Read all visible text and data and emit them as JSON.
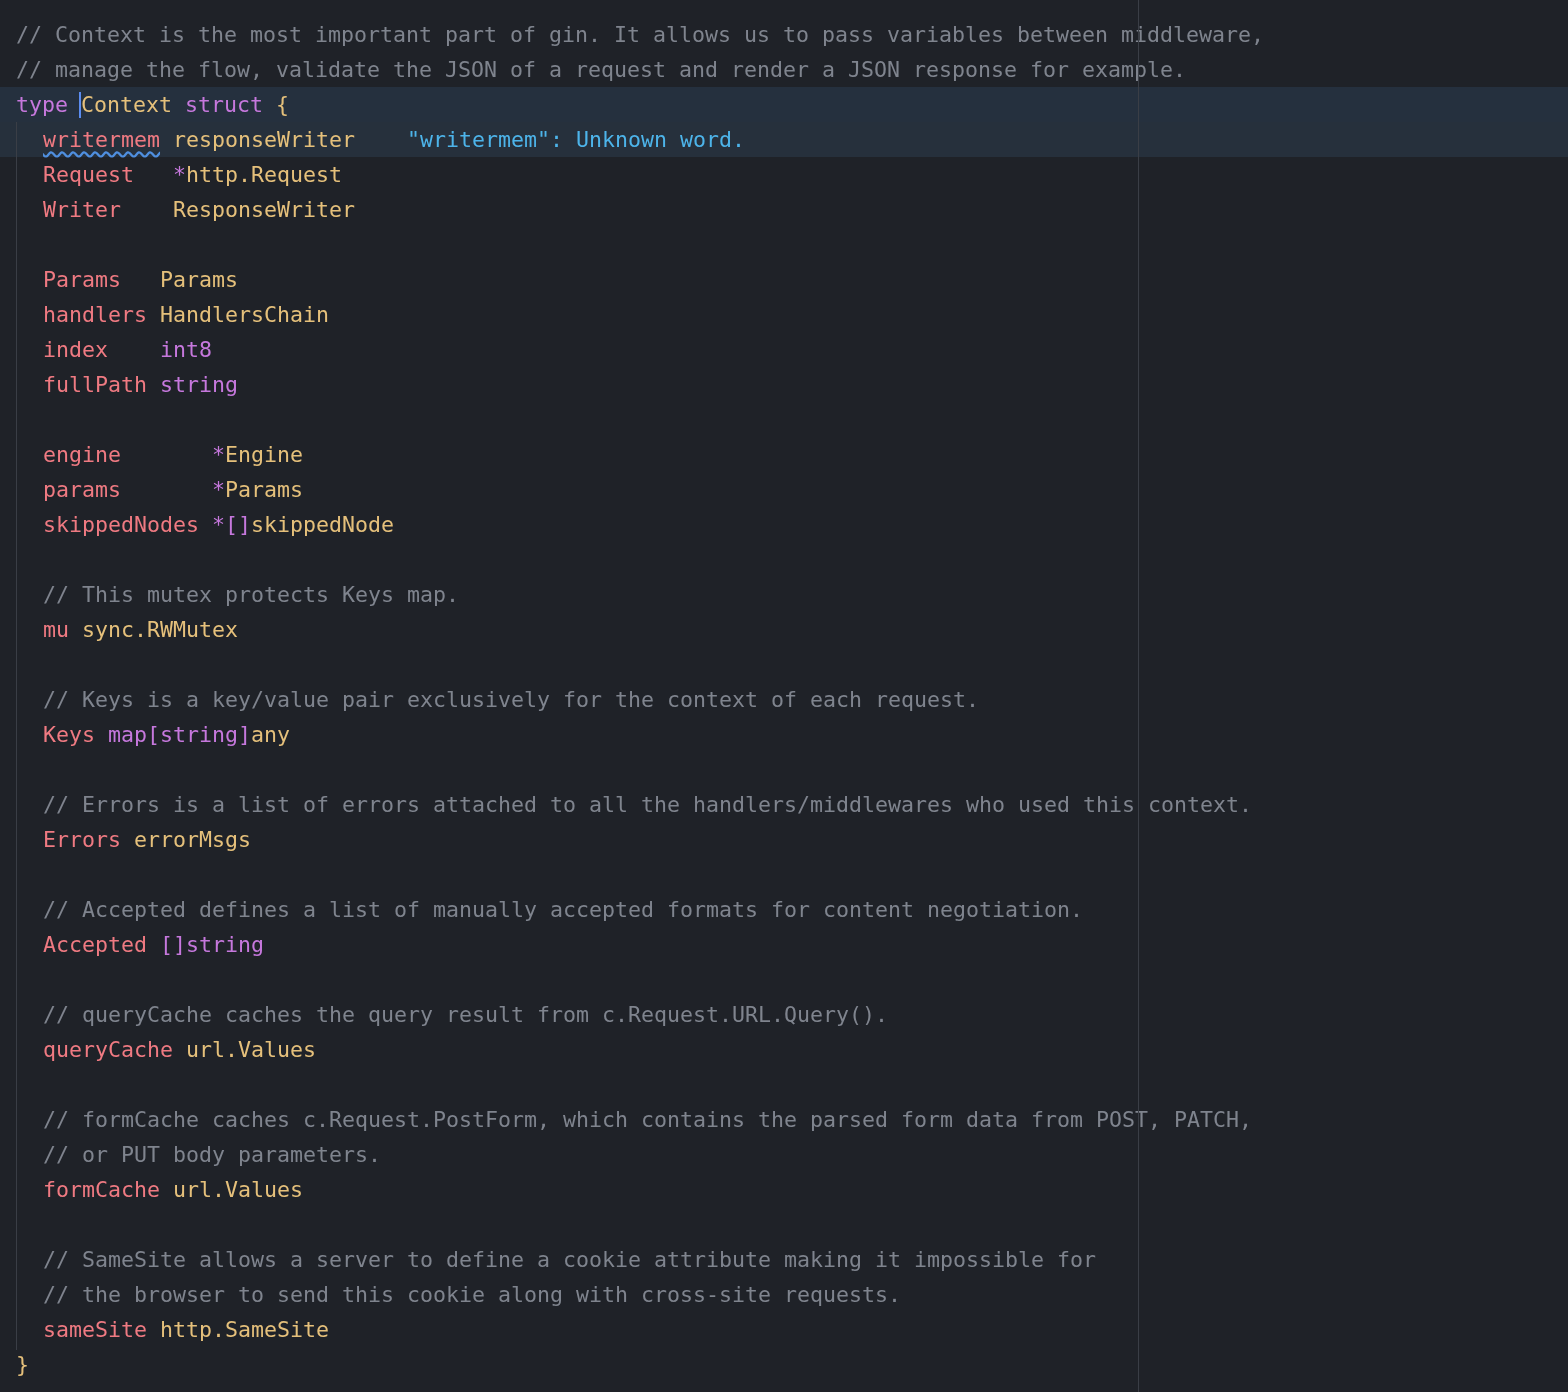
{
  "editor": {
    "lines": [
      {
        "kind": "comment",
        "text": "// Context is the most important part of gin. It allows us to pass variables between middleware,"
      },
      {
        "kind": "comment",
        "text": "// manage the flow, validate the JSON of a request and render a JSON response for example."
      },
      {
        "kind": "code",
        "current": true,
        "tokens": [
          {
            "kind": "keyword",
            "text": "type"
          },
          {
            "kind": "type",
            "text": "Context",
            "caret": true
          },
          {
            "kind": "keyword",
            "text": "struct"
          },
          {
            "kind": "brace",
            "text": "{"
          }
        ]
      },
      {
        "kind": "decl",
        "indent": true,
        "highlighted": true,
        "name": {
          "text": "writermem",
          "misspelled": true
        },
        "type": [
          {
            "kind": "type",
            "text": "responseWriter"
          }
        ],
        "hint": "\"writermem\": Unknown word."
      },
      {
        "kind": "decl",
        "indent": true,
        "name": {
          "text": "Request"
        },
        "type": [
          {
            "kind": "operator",
            "text": "*"
          },
          {
            "kind": "type",
            "text": "http.Request"
          }
        ]
      },
      {
        "kind": "decl",
        "indent": true,
        "name": {
          "text": "Writer"
        },
        "type": [
          {
            "kind": "type",
            "text": "ResponseWriter"
          }
        ]
      },
      {
        "kind": "blank"
      },
      {
        "kind": "decl",
        "indent": true,
        "name": {
          "text": "Params"
        },
        "type": [
          {
            "kind": "type",
            "text": "Params"
          }
        ]
      },
      {
        "kind": "decl",
        "indent": true,
        "name": {
          "text": "handlers"
        },
        "type": [
          {
            "kind": "type",
            "text": "HandlersChain"
          }
        ]
      },
      {
        "kind": "decl",
        "indent": true,
        "name": {
          "text": "index"
        },
        "type": [
          {
            "kind": "builtin",
            "text": "int8"
          }
        ]
      },
      {
        "kind": "decl",
        "indent": true,
        "name": {
          "text": "fullPath"
        },
        "type": [
          {
            "kind": "builtin",
            "text": "string"
          }
        ]
      },
      {
        "kind": "blank"
      },
      {
        "kind": "decl",
        "indent": true,
        "name": {
          "text": "engine"
        },
        "type": [
          {
            "kind": "operator",
            "text": "*"
          },
          {
            "kind": "type",
            "text": "Engine"
          }
        ]
      },
      {
        "kind": "decl",
        "indent": true,
        "name": {
          "text": "params"
        },
        "type": [
          {
            "kind": "operator",
            "text": "*"
          },
          {
            "kind": "type",
            "text": "Params"
          }
        ]
      },
      {
        "kind": "decl",
        "indent": true,
        "name": {
          "text": "skippedNodes"
        },
        "type": [
          {
            "kind": "operator",
            "text": "*[]"
          },
          {
            "kind": "type",
            "text": "skippedNode"
          }
        ]
      },
      {
        "kind": "blank"
      },
      {
        "kind": "comment",
        "indent": true,
        "text": "// This mutex protects Keys map."
      },
      {
        "kind": "decl",
        "indent": true,
        "name": {
          "text": "mu"
        },
        "type": [
          {
            "kind": "type",
            "text": "sync.RWMutex"
          }
        ]
      },
      {
        "kind": "blank"
      },
      {
        "kind": "comment",
        "indent": true,
        "text": "// Keys is a key/value pair exclusively for the context of each request."
      },
      {
        "kind": "decl",
        "indent": true,
        "name": {
          "text": "Keys"
        },
        "type": [
          {
            "kind": "builtin",
            "text": "map[string]"
          },
          {
            "kind": "type",
            "text": "any"
          }
        ]
      },
      {
        "kind": "blank"
      },
      {
        "kind": "comment",
        "indent": true,
        "text": "// Errors is a list of errors attached to all the handlers/middlewares who used this context."
      },
      {
        "kind": "decl",
        "indent": true,
        "name": {
          "text": "Errors"
        },
        "type": [
          {
            "kind": "type",
            "text": "errorMsgs"
          }
        ]
      },
      {
        "kind": "blank"
      },
      {
        "kind": "comment",
        "indent": true,
        "text": "// Accepted defines a list of manually accepted formats for content negotiation."
      },
      {
        "kind": "decl",
        "indent": true,
        "name": {
          "text": "Accepted"
        },
        "type": [
          {
            "kind": "operator",
            "text": "[]"
          },
          {
            "kind": "builtin",
            "text": "string"
          }
        ]
      },
      {
        "kind": "blank"
      },
      {
        "kind": "comment",
        "indent": true,
        "text": "// queryCache caches the query result from c.Request.URL.Query()."
      },
      {
        "kind": "decl",
        "indent": true,
        "name": {
          "text": "queryCache"
        },
        "type": [
          {
            "kind": "type",
            "text": "url.Values"
          }
        ]
      },
      {
        "kind": "blank"
      },
      {
        "kind": "comment",
        "indent": true,
        "text": "// formCache caches c.Request.PostForm, which contains the parsed form data from POST, PATCH,"
      },
      {
        "kind": "comment",
        "indent": true,
        "text": "// or PUT body parameters."
      },
      {
        "kind": "decl",
        "indent": true,
        "name": {
          "text": "formCache"
        },
        "type": [
          {
            "kind": "type",
            "text": "url.Values"
          }
        ]
      },
      {
        "kind": "blank"
      },
      {
        "kind": "comment",
        "indent": true,
        "text": "// SameSite allows a server to define a cookie attribute making it impossible for"
      },
      {
        "kind": "comment",
        "indent": true,
        "text": "// the browser to send this cookie along with cross-site requests."
      },
      {
        "kind": "decl",
        "indent": true,
        "name": {
          "text": "sameSite"
        },
        "type": [
          {
            "kind": "type",
            "text": "http.SameSite"
          }
        ]
      },
      {
        "kind": "code",
        "tokens": [
          {
            "kind": "brace",
            "text": "}"
          }
        ]
      }
    ]
  }
}
